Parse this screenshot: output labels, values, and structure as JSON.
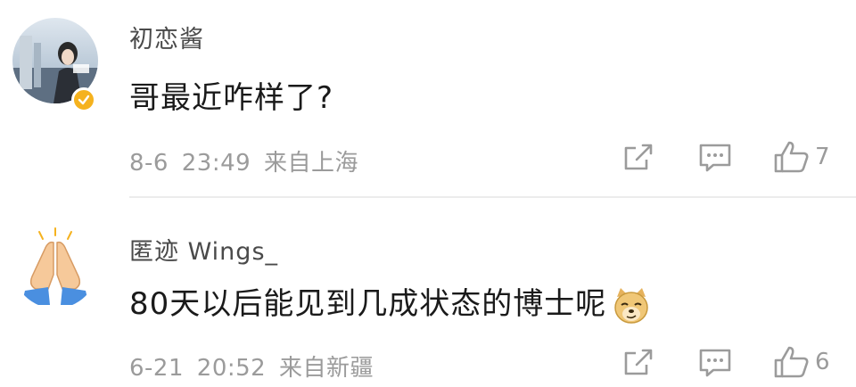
{
  "comments": [
    {
      "username": "初恋酱",
      "text": "哥最近咋样了?",
      "timestamp": "8-6 23:49",
      "location": "来自上海",
      "likes": "7",
      "verified": true,
      "icons": [
        "share-icon",
        "comment-icon",
        "like-icon"
      ]
    },
    {
      "username": "匿迹 Wings_",
      "text": "80天以后能见到几成状态的博士呢",
      "timestamp": "6-21 20:52",
      "location": "来自新疆",
      "likes": "6",
      "avatar_emoji": "folded-hands-emoji",
      "trailing_emoji": "doge-emoji",
      "icons": [
        "share-icon",
        "comment-icon",
        "like-icon"
      ]
    }
  ],
  "colors": {
    "verified_badge": "#f5b21e",
    "meta_text": "#9b9b9b",
    "body_text": "#1a1a1a",
    "username_text": "#4a4a4a"
  }
}
